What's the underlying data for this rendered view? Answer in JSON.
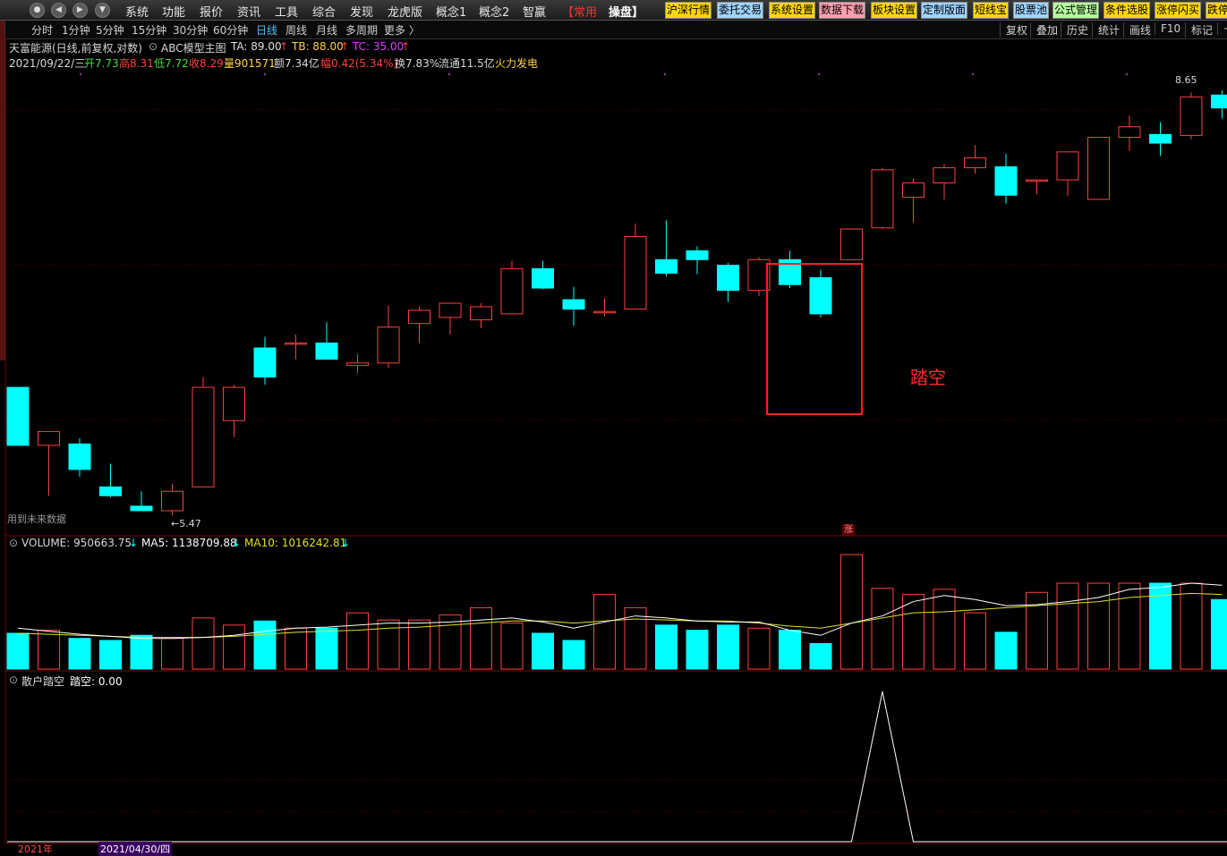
{
  "menubar": {
    "items": [
      "系统",
      "功能",
      "报价",
      "资讯",
      "工具",
      "综合",
      "发现",
      "龙虎版",
      "概念1",
      "概念2",
      "智嬴",
      "【常用",
      "操盘】"
    ],
    "quick_buttons": [
      {
        "label": "沪深行情",
        "bg": "#ffd700"
      },
      {
        "label": "委托交易",
        "bg": "#9fd3ff"
      },
      {
        "label": "系统设置",
        "bg": "#ffd700"
      },
      {
        "label": "数据下载",
        "bg": "#ff9fb0"
      },
      {
        "label": "板块设置",
        "bg": "#ffd700"
      },
      {
        "label": "定制版面",
        "bg": "#9fd3ff"
      },
      {
        "label": "短线宝",
        "bg": "#ffd700"
      },
      {
        "label": "股票池",
        "bg": "#9fd3ff"
      },
      {
        "label": "公式管理",
        "bg": "#b6ff9f"
      },
      {
        "label": "条件选股",
        "bg": "#ffd700"
      },
      {
        "label": "涨停闪买",
        "bg": "#ffd700"
      },
      {
        "label": "跌停",
        "bg": "#ffd700"
      }
    ]
  },
  "toolbar": {
    "periods": [
      "分时",
      "1分钟",
      "5分钟",
      "15分钟",
      "30分钟",
      "60分钟",
      "日线",
      "周线",
      "月线",
      "多周期",
      "更多 〉"
    ],
    "active_period": "日线",
    "right_tools": [
      "复权",
      "叠加",
      "历史",
      "统计",
      "画线",
      "F10",
      "标记",
      "+"
    ]
  },
  "header": {
    "stock_title": "天富能源(日线,前复权,对数)",
    "indicator_name": "ABC模型主图",
    "ta": "TA: 89.00",
    "tb": "TB: 88.00",
    "tc": "TC: 35.00",
    "date": "2021/09/22/三",
    "open": "开7.73",
    "high": "高8.31",
    "low": "低7.72",
    "close": "收8.29",
    "volume": "量901571",
    "amount": "额7.34亿",
    "change": "幅0.42(5.34%)",
    "turnover": "换7.83%",
    "float_shares": "流通11.5亿",
    "sector": "火力发电"
  },
  "price_panel": {
    "future_data_note": "用到未来数据",
    "low_marker": "←5.47",
    "high_marker": "8.65",
    "signal_label": "涨",
    "annotation": "踏空"
  },
  "volume_panel": {
    "volume": "VOLUME: 950663.75",
    "ma5": "MA5: 1138709.88",
    "ma10": "MA10: 1016242.81"
  },
  "indicator_panel": {
    "name": "散户踏空",
    "value": "踏空: 0.00"
  },
  "date_axis": {
    "left_label": "2021年",
    "cursor_date": "2021/04/30/四"
  },
  "colors": {
    "up": "#ff4040",
    "down": "#00ffff",
    "ma5": "#ffffff",
    "ma10": "#e0e020",
    "background": "#000000"
  },
  "chart_data": {
    "type": "candlestick",
    "price_scale": "log",
    "candles": [
      {
        "o": 6.38,
        "h": 6.38,
        "l": 5.95,
        "c": 5.95
      },
      {
        "o": 5.95,
        "h": 6.05,
        "l": 5.6,
        "c": 6.05
      },
      {
        "o": 5.96,
        "h": 6.0,
        "l": 5.73,
        "c": 5.78
      },
      {
        "o": 5.66,
        "h": 5.82,
        "l": 5.59,
        "c": 5.6
      },
      {
        "o": 5.53,
        "h": 5.63,
        "l": 5.5,
        "c": 5.5
      },
      {
        "o": 5.5,
        "h": 5.68,
        "l": 5.47,
        "c": 5.63
      },
      {
        "o": 5.66,
        "h": 6.46,
        "l": 5.66,
        "c": 6.38
      },
      {
        "o": 6.13,
        "h": 6.4,
        "l": 6.01,
        "c": 6.38
      },
      {
        "o": 6.69,
        "h": 6.78,
        "l": 6.4,
        "c": 6.46
      },
      {
        "o": 6.73,
        "h": 6.8,
        "l": 6.6,
        "c": 6.73
      },
      {
        "o": 6.73,
        "h": 6.9,
        "l": 6.6,
        "c": 6.6
      },
      {
        "o": 6.55,
        "h": 6.64,
        "l": 6.49,
        "c": 6.57
      },
      {
        "o": 6.57,
        "h": 7.04,
        "l": 6.53,
        "c": 6.86
      },
      {
        "o": 6.89,
        "h": 7.03,
        "l": 6.73,
        "c": 7.0
      },
      {
        "o": 6.94,
        "h": 7.06,
        "l": 6.8,
        "c": 7.06
      },
      {
        "o": 6.92,
        "h": 7.06,
        "l": 6.85,
        "c": 7.03
      },
      {
        "o": 6.97,
        "h": 7.43,
        "l": 6.97,
        "c": 7.36
      },
      {
        "o": 7.36,
        "h": 7.43,
        "l": 7.18,
        "c": 7.19
      },
      {
        "o": 7.09,
        "h": 7.2,
        "l": 6.87,
        "c": 7.01
      },
      {
        "o": 6.98,
        "h": 7.1,
        "l": 6.95,
        "c": 6.99
      },
      {
        "o": 7.01,
        "h": 7.77,
        "l": 7.01,
        "c": 7.65
      },
      {
        "o": 7.44,
        "h": 7.8,
        "l": 7.29,
        "c": 7.32
      },
      {
        "o": 7.52,
        "h": 7.56,
        "l": 7.31,
        "c": 7.44
      },
      {
        "o": 7.39,
        "h": 7.41,
        "l": 7.07,
        "c": 7.17
      },
      {
        "o": 7.17,
        "h": 7.46,
        "l": 7.12,
        "c": 7.44
      },
      {
        "o": 7.44,
        "h": 7.52,
        "l": 7.19,
        "c": 7.22
      },
      {
        "o": 7.28,
        "h": 7.35,
        "l": 6.94,
        "c": 6.97
      },
      {
        "o": 7.44,
        "h": 7.72,
        "l": 7.44,
        "c": 7.72
      },
      {
        "o": 7.73,
        "h": 8.31,
        "l": 7.72,
        "c": 8.29
      },
      {
        "o": 8.02,
        "h": 8.2,
        "l": 7.78,
        "c": 8.16
      },
      {
        "o": 8.16,
        "h": 8.35,
        "l": 8.0,
        "c": 8.31
      },
      {
        "o": 8.31,
        "h": 8.54,
        "l": 8.25,
        "c": 8.41
      },
      {
        "o": 8.32,
        "h": 8.45,
        "l": 7.96,
        "c": 8.04
      },
      {
        "o": 8.19,
        "h": 8.04,
        "l": 8.05,
        "c": 8.19
      },
      {
        "o": 8.19,
        "h": 8.35,
        "l": 8.03,
        "c": 8.47
      },
      {
        "o": 8.0,
        "h": 8.6,
        "l": 8.0,
        "c": 8.62
      },
      {
        "o": 8.62,
        "h": 8.85,
        "l": 8.48,
        "c": 8.73
      },
      {
        "o": 8.65,
        "h": 8.78,
        "l": 8.43,
        "c": 8.56
      },
      {
        "o": 8.64,
        "h": 9.1,
        "l": 8.6,
        "c": 9.05
      },
      {
        "o": 9.07,
        "h": 9.12,
        "l": 8.82,
        "c": 8.93
      }
    ],
    "volume": [
      0.35,
      0.38,
      0.3,
      0.28,
      0.33,
      0.3,
      0.5,
      0.43,
      0.47,
      0.4,
      0.4,
      0.55,
      0.48,
      0.48,
      0.53,
      0.6,
      0.45,
      0.35,
      0.28,
      0.73,
      0.6,
      0.43,
      0.38,
      0.43,
      0.4,
      0.38,
      0.25,
      1.12,
      0.79,
      0.73,
      0.78,
      0.55,
      0.36,
      0.75,
      0.84,
      0.84,
      0.84,
      0.84,
      0.84,
      0.68
    ],
    "ma5": [
      0.4,
      0.37,
      0.34,
      0.32,
      0.3,
      0.3,
      0.31,
      0.33,
      0.37,
      0.4,
      0.41,
      0.43,
      0.45,
      0.45,
      0.46,
      0.48,
      0.5,
      0.46,
      0.4,
      0.46,
      0.52,
      0.5,
      0.47,
      0.46,
      0.46,
      0.38,
      0.33,
      0.45,
      0.52,
      0.66,
      0.72,
      0.68,
      0.62,
      0.63,
      0.66,
      0.7,
      0.78,
      0.8,
      0.84,
      0.82
    ],
    "ma10": [
      0.35,
      0.34,
      0.33,
      0.32,
      0.31,
      0.31,
      0.31,
      0.32,
      0.34,
      0.36,
      0.37,
      0.38,
      0.4,
      0.41,
      0.43,
      0.45,
      0.47,
      0.47,
      0.45,
      0.47,
      0.49,
      0.48,
      0.47,
      0.47,
      0.45,
      0.42,
      0.4,
      0.45,
      0.5,
      0.55,
      0.56,
      0.58,
      0.6,
      0.62,
      0.64,
      0.66,
      0.7,
      0.72,
      0.74,
      0.73
    ],
    "tako_signal": [
      0,
      0,
      0,
      0,
      0,
      0,
      0,
      0,
      0,
      0,
      0,
      0,
      0,
      0,
      0,
      0,
      0,
      0,
      0,
      0,
      0,
      0,
      0,
      0,
      0,
      0,
      0,
      0,
      1,
      0,
      0,
      0,
      0,
      0,
      0,
      0,
      0,
      0,
      0,
      0
    ]
  }
}
